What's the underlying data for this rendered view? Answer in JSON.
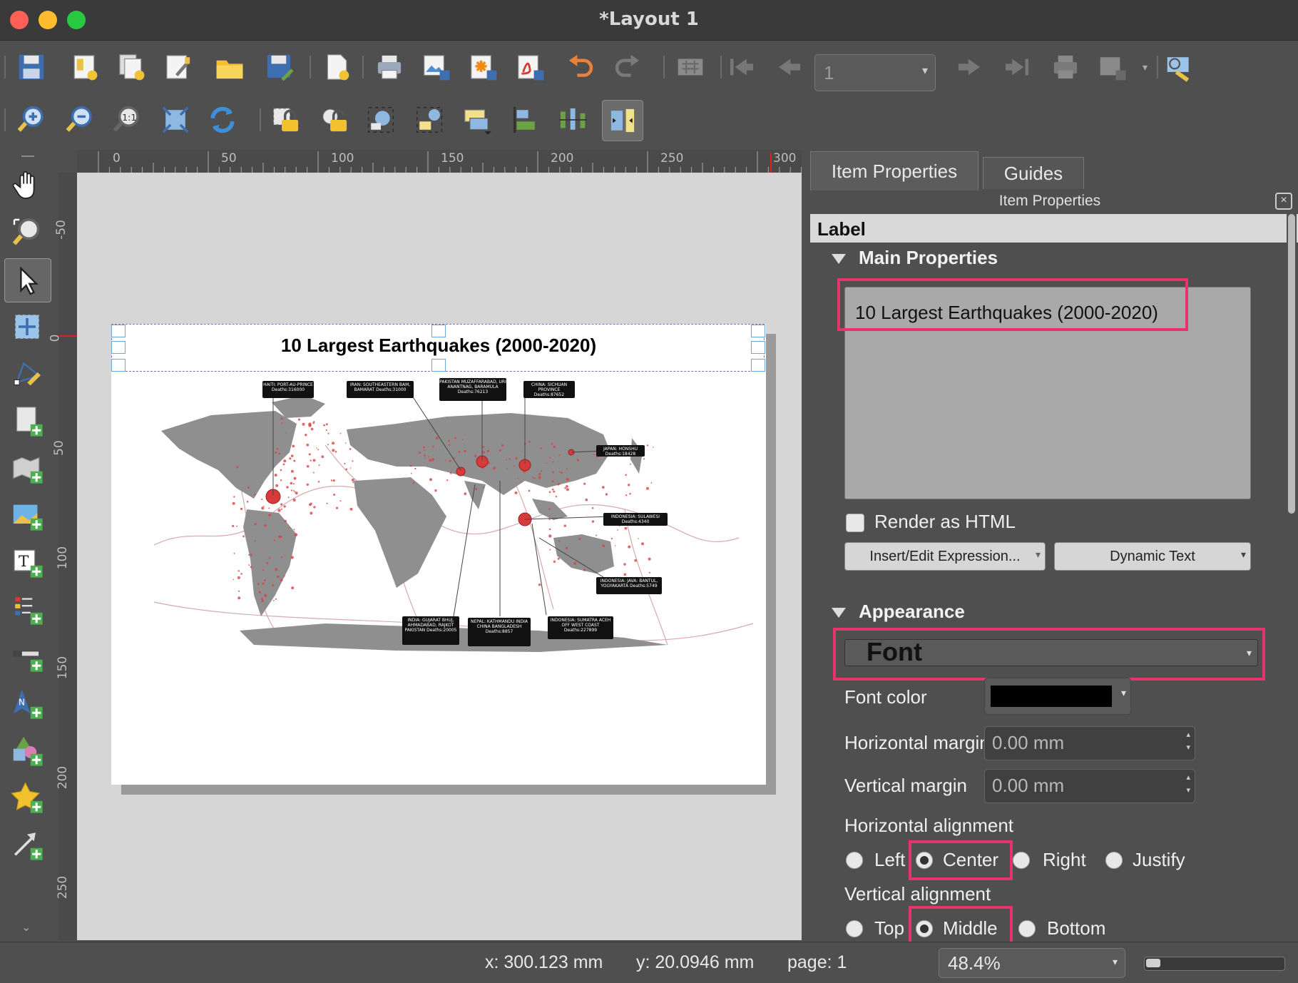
{
  "window": {
    "title": "*Layout 1"
  },
  "toolbar": {
    "page_number": "1"
  },
  "layout": {
    "title_label": "10 Largest Earthquakes (2000-2020)",
    "map_labels": [
      "HAITI: PORT-AU-PRINCE Deaths:316000",
      "IRAN: SOUTHEASTERN BAM, BAMARAT Deaths:31000",
      "PAKISTAN MUZAFFARABAD, URI ANANTNAG, BARAMULA Deaths:76213",
      "CHINA: SICHUAN PROVINCE Deaths:87652",
      "JAPAN: HONSHU Deaths:18428",
      "INDONESIA: SULAWESI Deaths:4340",
      "INDONESIA: JAVA: BANTUL, YOGYAKARTA Deaths:5749",
      "INDONESIA: SUMATRA ACEH OFF WEST COAST Deaths:227899",
      "NEPAL: KATHMANDU INDIA CHINA BANGLADESH Deaths:8857",
      "INDIA: GUJARAT BHUJ, AHMADABAD, RAJKOT PAKISTAN Deaths:20005"
    ]
  },
  "rulers": {
    "top": [
      "0",
      "50",
      "100",
      "150",
      "200",
      "250",
      "300"
    ],
    "left": [
      "-50",
      "0",
      "50",
      "100",
      "150",
      "200",
      "250"
    ]
  },
  "panel": {
    "tabs": [
      "Item Properties",
      "Guides"
    ],
    "title": "Item Properties",
    "item_type": "Label",
    "main_section": "Main Properties",
    "label_text": "10 Largest Earthquakes (2000-2020)",
    "render_html_label": "Render as HTML",
    "insert_expression_label": "Insert/Edit Expression...",
    "dynamic_text_label": "Dynamic Text",
    "appearance_section": "Appearance",
    "font_label": "Font",
    "font_color_label": "Font color",
    "font_color": "#000000",
    "horizontal_margin_label": "Horizontal margin",
    "horizontal_margin_value": "0.00 mm",
    "vertical_margin_label": "Vertical margin",
    "vertical_margin_value": "0.00 mm",
    "halign_label": "Horizontal alignment",
    "halign_options": [
      "Left",
      "Center",
      "Right",
      "Justify"
    ],
    "halign_selected": "Center",
    "valign_label": "Vertical alignment",
    "valign_options": [
      "Top",
      "Middle",
      "Bottom"
    ],
    "valign_selected": "Middle"
  },
  "status": {
    "x": "x: 300.123 mm",
    "y": "y: 20.0946 mm",
    "page": "page: 1",
    "zoom": "48.4%",
    "zoom_fraction": 0.484
  },
  "colors": {
    "highlight": "#e6336c",
    "accent": "#4a90d9"
  }
}
